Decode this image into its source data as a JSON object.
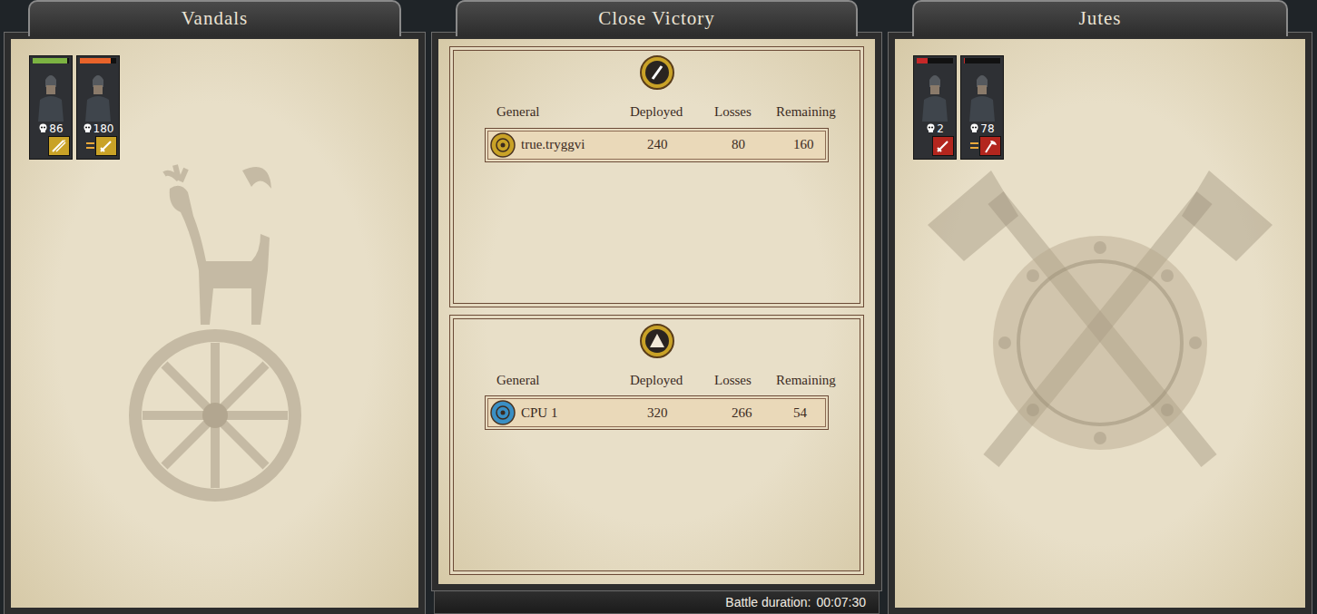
{
  "result": {
    "title": "Close Victory"
  },
  "columns": [
    "General",
    "Deployed",
    "Losses",
    "Remaining"
  ],
  "factions": [
    {
      "name": "Vandals",
      "color": "#c9a227",
      "units": [
        {
          "kills": "86",
          "health": 0.95,
          "color": "#7cb342",
          "kind": "cavalry",
          "rank": 0
        },
        {
          "kills": "180",
          "health": 0.85,
          "color": "#e8632a",
          "kind": "sword",
          "rank": 2
        }
      ]
    },
    {
      "name": "Jutes",
      "color": "#b3261e",
      "units": [
        {
          "kills": "2",
          "health": 0.3,
          "color": "#c62828",
          "kind": "sword",
          "rank": 0
        },
        {
          "kills": "78",
          "health": 0.03,
          "color": "#c62828",
          "kind": "axe",
          "rank": 2
        }
      ]
    }
  ],
  "sides": [
    {
      "generals": [
        {
          "name": "true.tryggvi",
          "deployed": "240",
          "losses": "80",
          "remaining": "160",
          "color": "#c9a227"
        }
      ]
    },
    {
      "generals": [
        {
          "name": "CPU 1",
          "deployed": "320",
          "losses": "266",
          "remaining": "54",
          "color": "#3a8fc4"
        }
      ]
    }
  ],
  "footer": {
    "label": "Battle duration:",
    "value": "00:07:30"
  }
}
